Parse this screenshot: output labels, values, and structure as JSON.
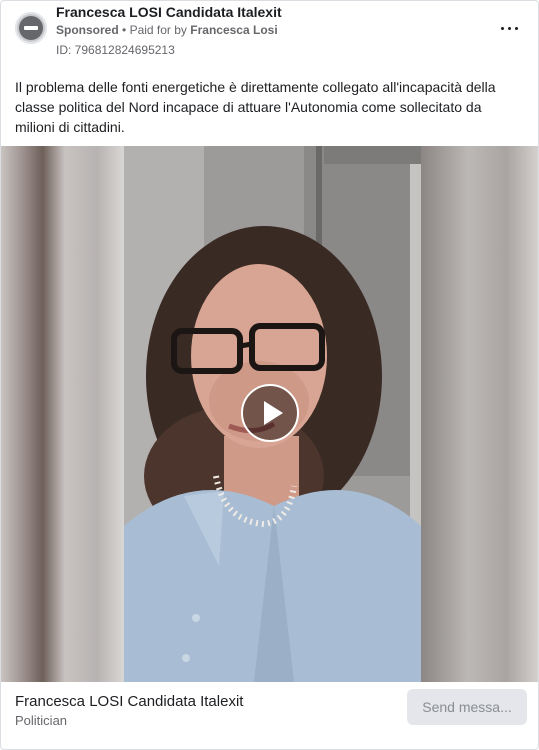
{
  "post": {
    "page_name": "Francesca LOSI Candidata Italexit",
    "sponsored_label": "Sponsored",
    "separator": "•",
    "paid_for_label": "Paid for by",
    "funder": "Francesca Losi",
    "ad_id": "ID: 796812824695213",
    "body_text": "Il problema delle fonti energetiche è direttamente collegato all'incapacità della classe politica del Nord incapace di attuare l'Autonomia come sollecitato da milioni di cittadini."
  },
  "icons": {
    "avatar": "no-entry-icon",
    "more": "more-horizontal-icon",
    "play": "play-icon"
  },
  "footer": {
    "title": "Francesca LOSI Candidata Italexit",
    "subtitle": "Politician",
    "cta_label": "Send messa..."
  },
  "colors": {
    "text": "#1c1e21",
    "secondary_text": "#65676b",
    "cta_bg": "#e4e6eb",
    "cta_text": "#8a8d91"
  }
}
